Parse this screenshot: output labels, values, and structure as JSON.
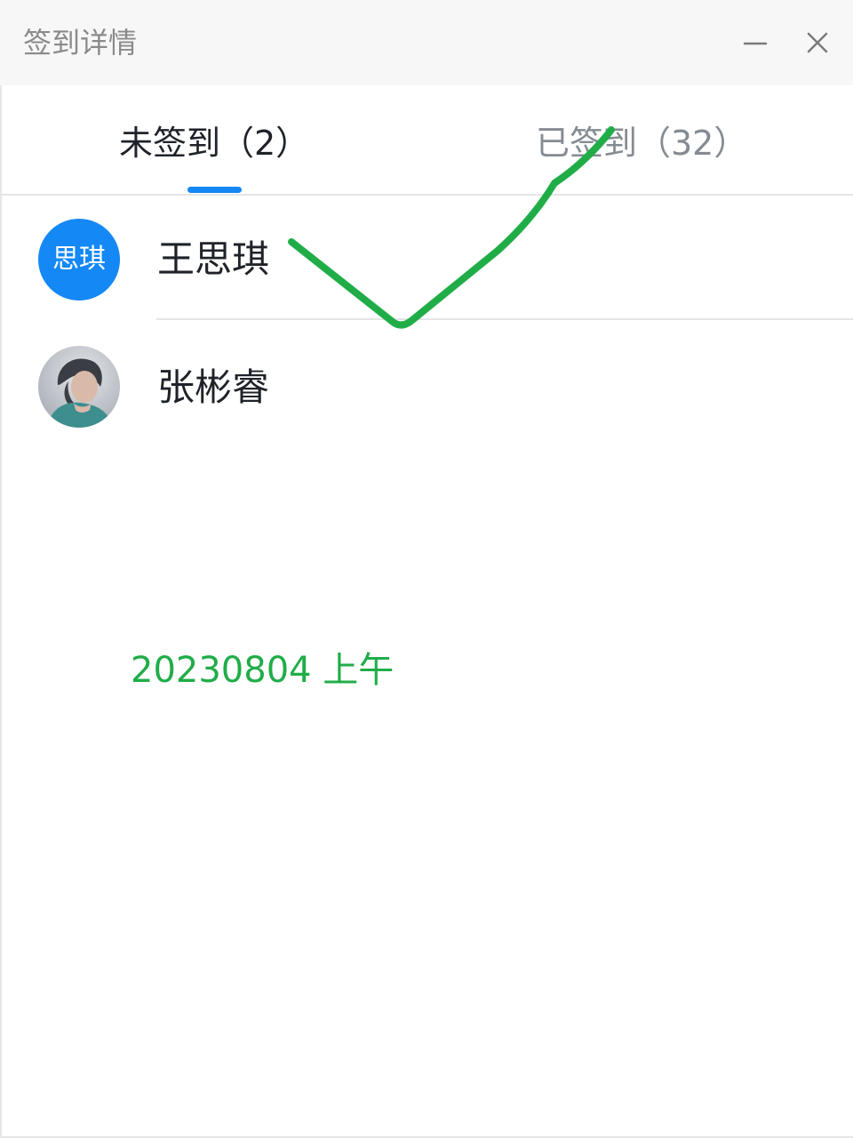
{
  "window": {
    "title": "签到详情",
    "minimize_icon": "minimize-icon",
    "close_icon": "close-icon"
  },
  "tabs": [
    {
      "label": "未签到（2）",
      "active": true
    },
    {
      "label": "已签到（32）",
      "active": false
    }
  ],
  "list": {
    "items": [
      {
        "avatar_text": "思琪",
        "name": "王思琪",
        "avatar_color": "#1488f5"
      },
      {
        "avatar_text": "",
        "name": "张彬睿",
        "avatar_type": "photo"
      }
    ]
  },
  "annotation": {
    "text": "20230804 上午",
    "color": "#20ad48",
    "mark_icon": "checkmark-icon"
  },
  "colors": {
    "accent": "#1488f5",
    "text_primary": "#1f2329",
    "text_secondary": "#858b92",
    "annotation": "#20ad48"
  }
}
